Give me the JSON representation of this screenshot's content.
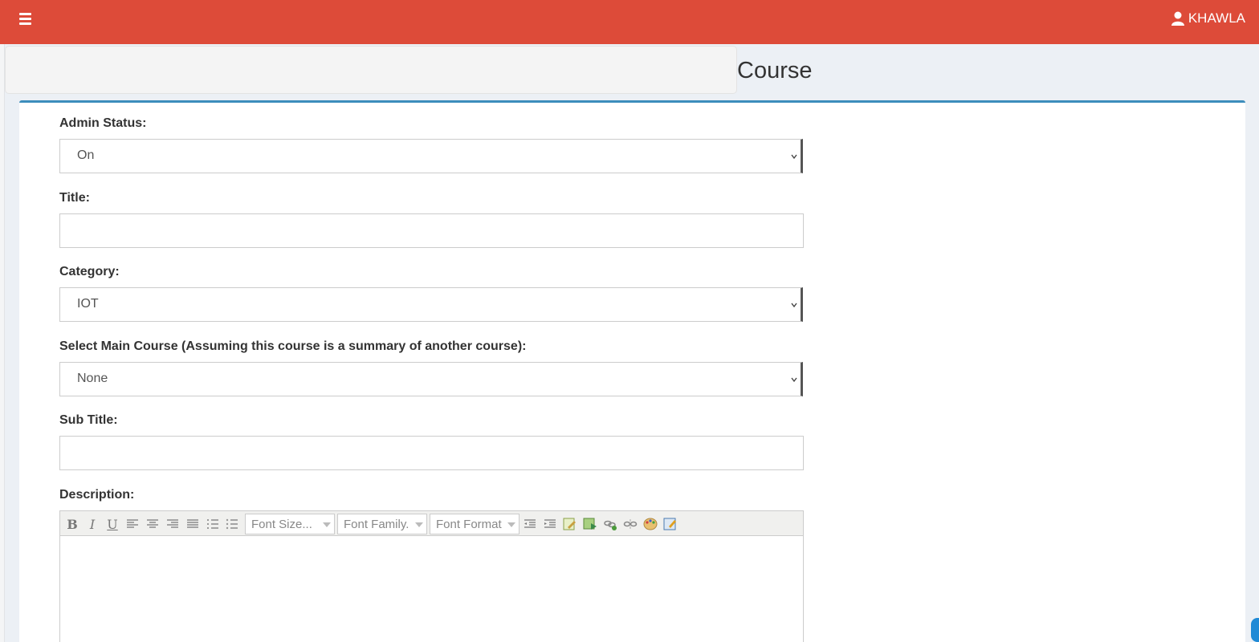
{
  "topbar": {
    "user_name": "KHAWLA"
  },
  "page": {
    "title": "Course"
  },
  "form": {
    "admin_status": {
      "label": "Admin Status:",
      "value": "On"
    },
    "title": {
      "label": "Title:",
      "value": ""
    },
    "category": {
      "label": "Category:",
      "value": "IOT"
    },
    "main_course": {
      "label": "Select Main Course (Assuming this course is a summary of another course):",
      "value": "None"
    },
    "sub_title": {
      "label": "Sub Title:",
      "value": ""
    },
    "description": {
      "label": "Description:",
      "font_size": "Font Size...",
      "font_family": "Font Family.",
      "font_format": "Font Format",
      "bold": "B",
      "italic": "I",
      "underline": "U"
    }
  },
  "colors": {
    "header": "#dd4b39",
    "panel_accent": "#3c8dbc",
    "background": "#ecf0f5"
  }
}
